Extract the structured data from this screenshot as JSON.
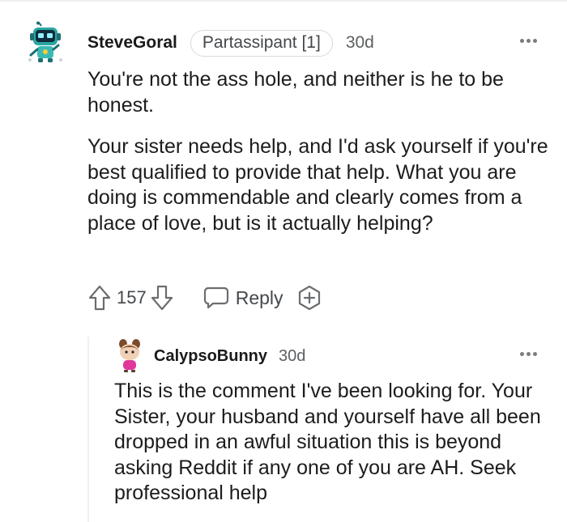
{
  "comment": {
    "author": "SteveGoral",
    "flair": "Partassipant [1]",
    "age": "30d",
    "paragraphs": [
      "You're not the ass hole, and neither is he to be honest.",
      "Your sister needs help, and I'd ask yourself if you're best qualified to provide that help. What you are doing is commendable and clearly comes from a place of love, but is it actually helping?"
    ],
    "score": "157",
    "reply_label": "Reply"
  },
  "reply": {
    "author": "CalypsoBunny",
    "age": "30d",
    "text": "This is the comment I've been looking for. Your Sister, your husband and yourself have all been dropped in an awful situation this is beyond asking Reddit if any one of you are AH. Seek professional help"
  },
  "icons": {
    "upvote": "upvote-arrow-icon",
    "downvote": "downvote-arrow-icon",
    "reply": "speech-bubble-icon",
    "award": "award-plus-icon",
    "more": "more-dots-icon"
  },
  "colors": {
    "text": "#1c1c1c",
    "meta": "#5c5f61",
    "divider": "#edeff1",
    "avatar_robot": "#24a0a0"
  }
}
